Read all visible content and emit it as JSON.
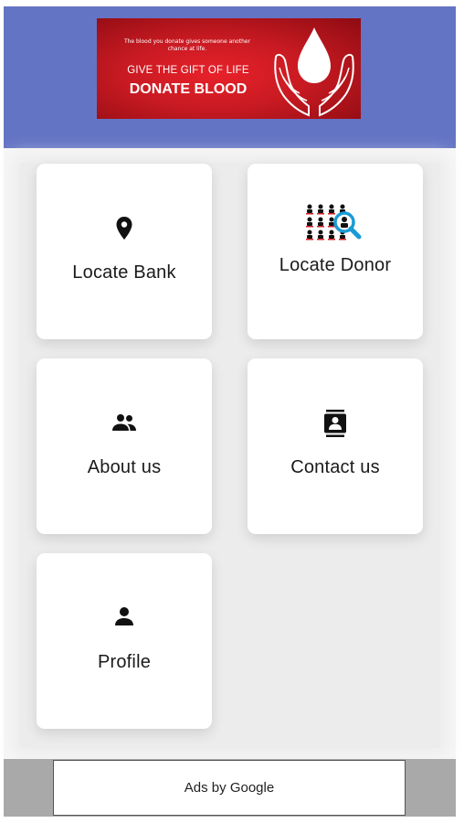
{
  "banner": {
    "tagline": "The blood you donate gives someone another chance at life.",
    "line1": "GIVE THE GIFT OF LIFE",
    "line2": "DONATE BLOOD"
  },
  "menu": {
    "items": [
      {
        "label": "Locate Bank",
        "icon": "location-pin-icon"
      },
      {
        "label": "Locate Donor",
        "icon": "donor-search-icon"
      },
      {
        "label": "About us",
        "icon": "people-icon"
      },
      {
        "label": "Contact us",
        "icon": "contact-card-icon"
      },
      {
        "label": "Profile",
        "icon": "person-icon"
      }
    ]
  },
  "ad": {
    "label": "Ads by Google"
  },
  "colors": {
    "header": "#6474c4",
    "banner_red": "#c81a22",
    "card": "#ffffff",
    "ad_bar": "#a9a9a9",
    "search_accent": "#1a9ad6"
  }
}
